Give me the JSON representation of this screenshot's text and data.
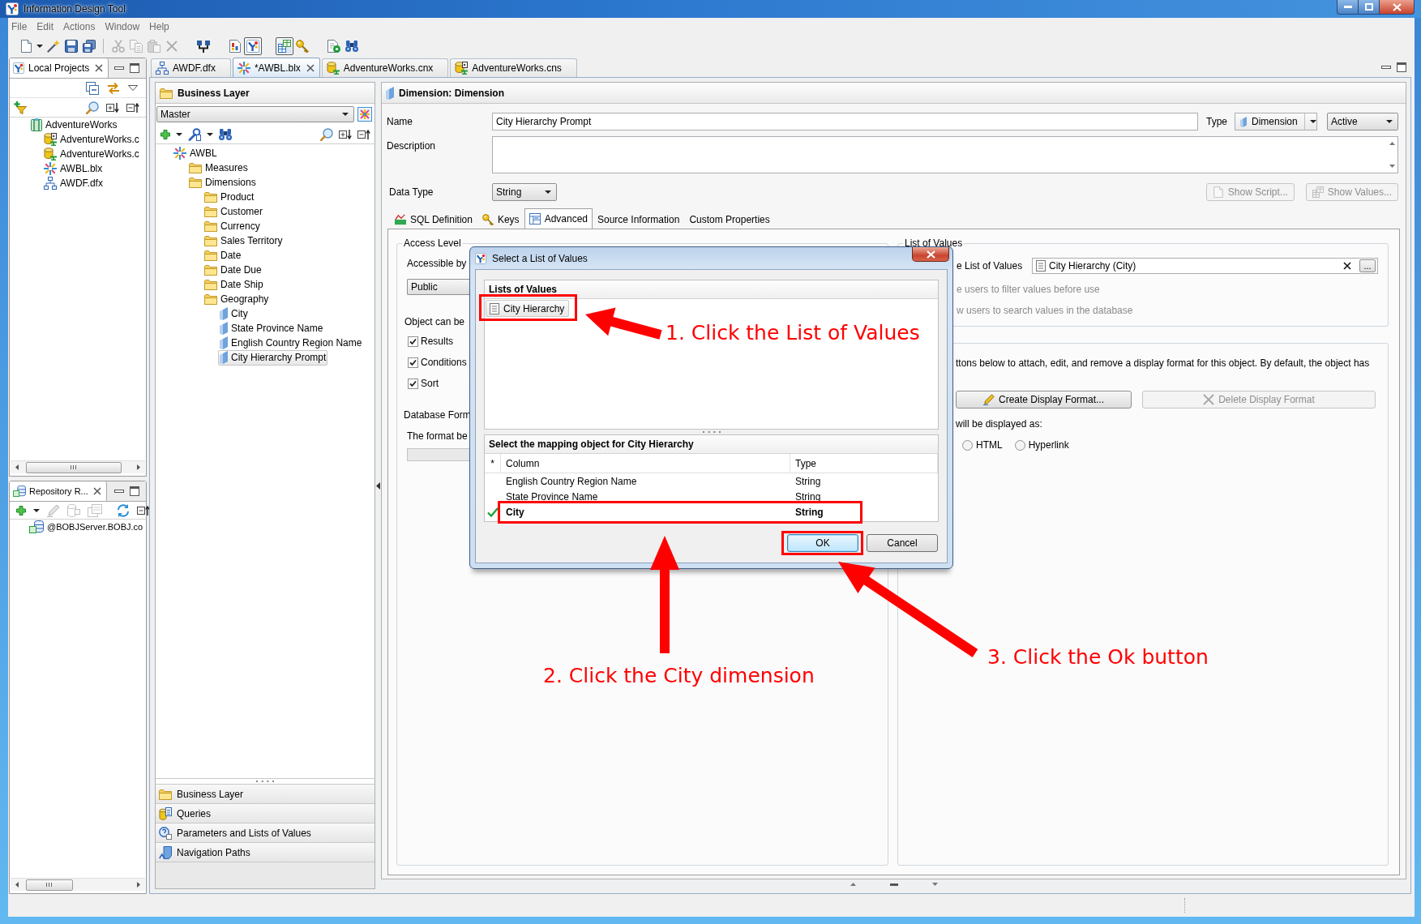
{
  "window": {
    "title": "Information Design Tool"
  },
  "menu": [
    "File",
    "Edit",
    "Actions",
    "Window",
    "Help"
  ],
  "toolbar": [
    [
      {
        "kind": "new",
        "selected": false,
        "disabled": false
      },
      {
        "kind": "menu",
        "selected": false,
        "disabled": false
      },
      {
        "kind": "wand",
        "selected": false,
        "disabled": false
      },
      {
        "kind": "save",
        "selected": false,
        "disabled": false
      },
      {
        "kind": "save_all",
        "selected": false,
        "disabled": false
      }
    ],
    [
      {
        "kind": "cut",
        "selected": false,
        "disabled": true
      },
      {
        "kind": "copy",
        "selected": false,
        "disabled": true
      },
      {
        "kind": "paste",
        "selected": false,
        "disabled": true
      },
      {
        "kind": "delete",
        "selected": false,
        "disabled": true
      }
    ],
    [
      {
        "kind": "connect",
        "selected": false,
        "disabled": false
      }
    ],
    [
      {
        "kind": "report",
        "selected": false,
        "disabled": false
      },
      {
        "kind": "logo",
        "selected": true,
        "disabled": false
      }
    ],
    [
      {
        "kind": "tables",
        "selected": true,
        "disabled": false
      },
      {
        "kind": "key",
        "selected": false,
        "disabled": false
      }
    ],
    [
      {
        "kind": "check",
        "selected": false,
        "disabled": false
      },
      {
        "kind": "find",
        "selected": false,
        "disabled": false
      }
    ]
  ],
  "local_projects": {
    "tab": "Local Projects",
    "tree": [
      {
        "label": "AdventureWorks",
        "kind": "project",
        "selected": false,
        "children": [
          {
            "label": "AdventureWorks.c",
            "kind": "connection_shortcut",
            "selected": false
          },
          {
            "label": "AdventureWorks.c",
            "kind": "connection",
            "selected": false
          },
          {
            "label": "AWBL.blx",
            "kind": "business_layer",
            "selected": false
          },
          {
            "label": "AWDF.dfx",
            "kind": "data_foundation",
            "selected": false
          }
        ]
      }
    ]
  },
  "repository": {
    "tab": "Repository R...",
    "tree": [
      {
        "label": "@BOBJServer.BOBJ.co",
        "kind": "server",
        "selected": false
      }
    ]
  },
  "editor_tabs": [
    {
      "label": "AWDF.dfx",
      "kind": "data_foundation",
      "selected": false
    },
    {
      "label": "*AWBL.blx",
      "kind": "business_layer",
      "selected": true
    },
    {
      "label": "AdventureWorks.cnx",
      "kind": "connection",
      "selected": false
    },
    {
      "label": "AdventureWorks.cns",
      "kind": "connection_shortcut",
      "selected": false
    }
  ],
  "business_layer": {
    "title": "Business Layer",
    "view": "Master",
    "tree": [
      {
        "label": "AWBL",
        "kind": "business_layer",
        "selected": false,
        "children": [
          {
            "label": "Measures",
            "kind": "folder",
            "selected": false
          },
          {
            "label": "Dimensions",
            "kind": "folder",
            "selected": false,
            "children": [
              {
                "label": "Product",
                "kind": "folder",
                "selected": false
              },
              {
                "label": "Customer",
                "kind": "folder",
                "selected": false
              },
              {
                "label": "Currency",
                "kind": "folder",
                "selected": false
              },
              {
                "label": "Sales Territory",
                "kind": "folder",
                "selected": false
              },
              {
                "label": "Date",
                "kind": "folder",
                "selected": false
              },
              {
                "label": "Date Due",
                "kind": "folder",
                "selected": false
              },
              {
                "label": "Date Ship",
                "kind": "folder",
                "selected": false
              },
              {
                "label": "Geography",
                "kind": "folder",
                "selected": false,
                "children": [
                  {
                    "label": "City",
                    "kind": "dimension",
                    "selected": false
                  },
                  {
                    "label": "State Province Name",
                    "kind": "dimension",
                    "selected": false
                  },
                  {
                    "label": "English Country Region Name",
                    "kind": "dimension",
                    "selected": false
                  },
                  {
                    "label": "City Hierarchy Prompt",
                    "kind": "dimension",
                    "selected": true
                  }
                ]
              }
            ]
          }
        ]
      }
    ],
    "sections": [
      {
        "label": "Business Layer",
        "kind": "folder"
      },
      {
        "label": "Queries",
        "kind": "queries"
      },
      {
        "label": "Parameters and Lists of Values",
        "kind": "parameters"
      },
      {
        "label": "Navigation Paths",
        "kind": "navigation"
      }
    ]
  },
  "dimension": {
    "title": "Dimension: Dimension",
    "name": {
      "label": "Name",
      "value": "City Hierarchy Prompt"
    },
    "type": {
      "label": "Type",
      "value": "Dimension",
      "status": "Active"
    },
    "description": {
      "label": "Description"
    },
    "data_type": {
      "label": "Data Type",
      "value": "String"
    },
    "buttons": [
      {
        "label": "Show Script...",
        "kind": "script",
        "disabled": true
      },
      {
        "label": "Show Values...",
        "kind": "values",
        "disabled": true
      }
    ],
    "tabs": [
      {
        "label": "SQL Definition",
        "kind": "sql",
        "selected": false
      },
      {
        "label": "Keys",
        "kind": "keys",
        "selected": false
      },
      {
        "label": "Advanced",
        "kind": "advanced",
        "selected": true
      },
      {
        "label": "Source Information",
        "kind": "plain",
        "selected": false
      },
      {
        "label": "Custom Properties",
        "kind": "plain",
        "selected": false
      }
    ],
    "advanced": {
      "access_level": {
        "title": "Access Level",
        "label": "Accessible by",
        "value": "Public"
      },
      "usage": {
        "title": "Object can be",
        "options": [
          {
            "label": "Results",
            "checked": true
          },
          {
            "label": "Conditions",
            "checked": true
          },
          {
            "label": "Sort",
            "checked": true
          }
        ]
      },
      "database_format": {
        "title": "Database Form",
        "label": "The format be"
      },
      "list_of_values": {
        "title": "List of Values",
        "label": "e List of Values",
        "value": "City Hierarchy (City)",
        "browse": "...",
        "options": [
          {
            "label": "e users to filter values before use",
            "disabled": true
          },
          {
            "label": "w users to search values in the database",
            "disabled": true
          }
        ]
      },
      "display_format": {
        "text": "ttons below to attach, edit, and remove a display format for this object. By default, the object has",
        "buttons": [
          {
            "label": "Create Display Format...",
            "kind": "create",
            "disabled": false
          },
          {
            "label": "Delete Display Format",
            "kind": "delete",
            "disabled": true
          }
        ],
        "label": "will be displayed as:",
        "options": [
          {
            "label": "HTML",
            "selected": false
          },
          {
            "label": "Hyperlink",
            "selected": false
          }
        ]
      }
    }
  },
  "dialog": {
    "title": "Select a List of Values",
    "lists_header": "Lists of Values",
    "lists": [
      {
        "label": "City Hierarchy",
        "selected": true
      }
    ],
    "mapping_header": "Select the mapping object for City Hierarchy",
    "columns": [
      "*",
      "Column",
      "Type"
    ],
    "rows": [
      {
        "column": "English Country Region Name",
        "type": "String",
        "selected": false
      },
      {
        "column": "State Province Name",
        "type": "String",
        "selected": false
      },
      {
        "column": "City",
        "type": "String",
        "selected": true
      }
    ],
    "buttons": [
      {
        "label": "OK",
        "default": true
      },
      {
        "label": "Cancel",
        "default": false
      }
    ]
  },
  "annotations": [
    {
      "text": "1. Click the List of Values"
    },
    {
      "text": "2. Click the City dimension"
    },
    {
      "text": "3. Click the Ok button"
    }
  ]
}
